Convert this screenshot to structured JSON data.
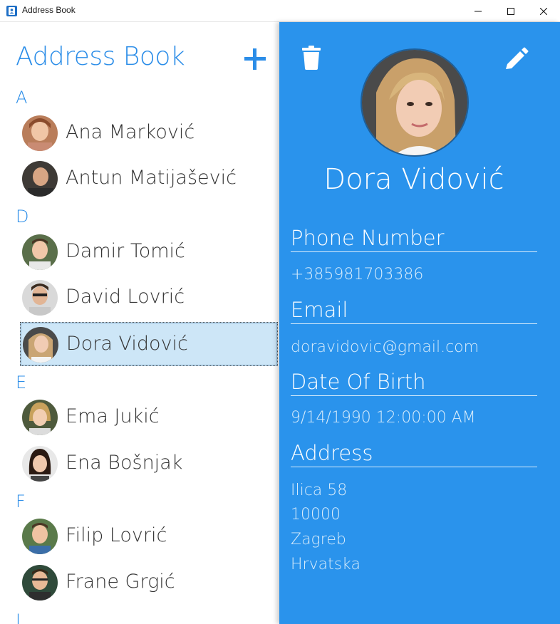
{
  "window": {
    "title": "Address Book",
    "icons": {
      "app": "address-book-icon",
      "minimize": "minimize-icon",
      "maximize": "maximize-icon",
      "close": "close-icon"
    }
  },
  "list": {
    "title": "Address Book",
    "add_icon": "plus-icon",
    "groups": [
      {
        "letter": "A",
        "contacts": [
          "Ana Marković",
          "Antun Matijašević"
        ]
      },
      {
        "letter": "D",
        "contacts": [
          "Damir Tomić",
          "David Lovrić",
          "Dora Vidović"
        ]
      },
      {
        "letter": "E",
        "contacts": [
          "Ema Jukić",
          "Ena Bošnjak"
        ]
      },
      {
        "letter": "F",
        "contacts": [
          "Filip Lovrić",
          "Frane Grgić"
        ]
      },
      {
        "letter": "I",
        "contacts": []
      }
    ],
    "selected": "Dora Vidović"
  },
  "detail": {
    "name": "Dora Vidović",
    "delete_icon": "trash-icon",
    "edit_icon": "pencil-icon",
    "phone_label": "Phone Number",
    "phone": "+385981703386",
    "email_label": "Email",
    "email": "doravidovic@gmail.com",
    "dob_label": "Date Of Birth",
    "dob": "9/14/1990 12:00:00 AM",
    "address_label": "Address",
    "address_lines": [
      "Ilica 58",
      "10000",
      "Zagreb",
      "Hrvatska"
    ]
  },
  "colors": {
    "accent": "#2b8de8",
    "detail_bg": "#2a93ec",
    "selected_bg": "#cde6f7"
  }
}
